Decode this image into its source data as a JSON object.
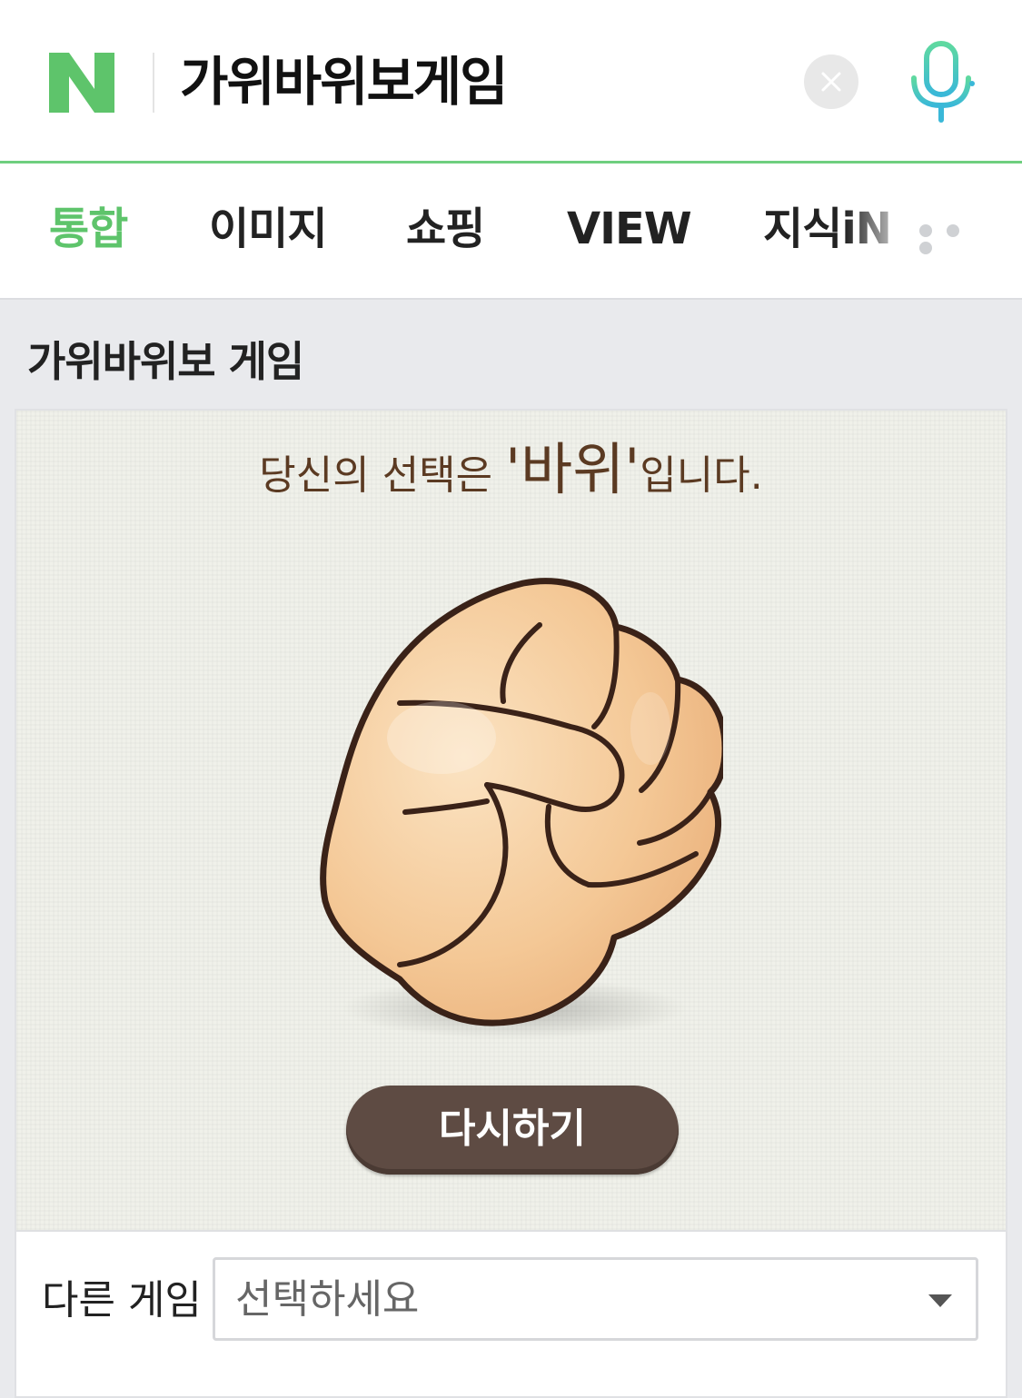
{
  "search": {
    "query": "가위바위보게임"
  },
  "tabs": [
    {
      "label": "통합",
      "active": true
    },
    {
      "label": "이미지"
    },
    {
      "label": "쇼핑"
    },
    {
      "label": "VIEW"
    },
    {
      "label": "지식iN"
    }
  ],
  "section": {
    "title": "가위바위보 게임"
  },
  "game": {
    "message_prefix": "당신의 선택은 ",
    "choice": "'바위'",
    "message_suffix": "입니다.",
    "retry_label": "다시하기"
  },
  "other_game": {
    "label": "다른 게임",
    "select_value": "선택하세요"
  },
  "colors": {
    "brand": "#5ec46b",
    "button": "#5e4b43",
    "message": "#5b3a22"
  },
  "icons": {
    "logo": "naver-n-logo",
    "clear": "close-icon",
    "mic": "mic-icon",
    "more": "more-dots-icon",
    "dropdown": "caret-down-icon"
  }
}
